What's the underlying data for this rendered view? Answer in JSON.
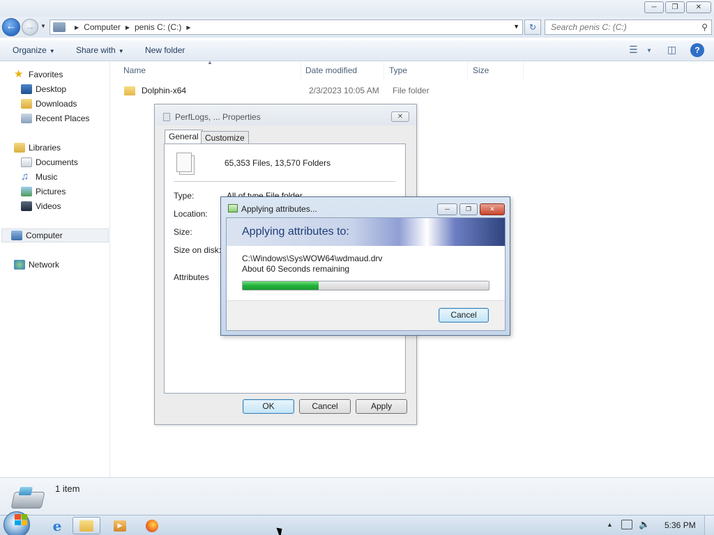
{
  "explorer": {
    "nav": {
      "back_glyph": "←",
      "forward_glyph": "→",
      "breadcrumb": [
        "Computer",
        "penis C: (C:)"
      ],
      "search_placeholder": "Search penis C: (C:)"
    },
    "toolbar": {
      "organize": "Organize",
      "share_with": "Share with",
      "new_folder": "New folder"
    },
    "sidebar": {
      "favorites": {
        "label": "Favorites",
        "items": [
          "Desktop",
          "Downloads",
          "Recent Places"
        ]
      },
      "libraries": {
        "label": "Libraries",
        "items": [
          "Documents",
          "Music",
          "Pictures",
          "Videos"
        ]
      },
      "computer": "Computer",
      "network": "Network"
    },
    "columns": [
      "Name",
      "Date modified",
      "Type",
      "Size"
    ],
    "rows": [
      {
        "name": "Dolphin-x64",
        "date": "2/3/2023 10:05 AM",
        "type": "File folder",
        "size": ""
      }
    ],
    "status": {
      "item_count": "1 item"
    }
  },
  "properties_dialog": {
    "title": "PerfLogs, ... Properties",
    "tabs": [
      "General",
      "Customize"
    ],
    "summary": "65,353 Files, 13,570 Folders",
    "labels": {
      "type": "Type:",
      "type_value": "All of type File folder",
      "location": "Location:",
      "size": "Size:",
      "size_on_disk": "Size on disk:",
      "attributes": "Attributes"
    },
    "buttons": {
      "ok": "OK",
      "cancel": "Cancel",
      "apply": "Apply"
    }
  },
  "apply_dialog": {
    "title": "Applying attributes...",
    "heading": "Applying attributes to:",
    "current_file": "C:\\Windows\\SysWOW64\\wdmaud.drv",
    "time_remaining": "About 60 Seconds remaining",
    "progress_fraction": 0.31,
    "cancel_label": "Cancel"
  },
  "taskbar": {
    "clock": "5:36 PM",
    "apps": [
      "internet-explorer",
      "windows-explorer",
      "media-player",
      "firefox"
    ]
  },
  "colors": {
    "progress_green": "#23b13b",
    "heading_blue": "#1d3c77",
    "selection_bg": "#eef1f5"
  }
}
